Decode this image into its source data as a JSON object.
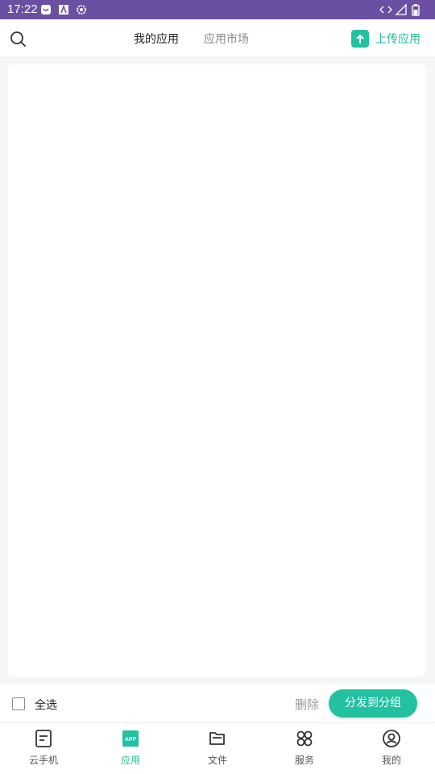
{
  "status_bar": {
    "time": "17:22"
  },
  "header": {
    "tabs": [
      {
        "label": "我的应用",
        "active": true
      },
      {
        "label": "应用市场",
        "active": false
      }
    ],
    "upload_label": "上传应用"
  },
  "action_bar": {
    "select_all_label": "全选",
    "delete_label": "删除",
    "distribute_label": "分发到分组"
  },
  "bottom_nav": {
    "items": [
      {
        "label": "云手机",
        "icon": "phone-document-icon",
        "active": false
      },
      {
        "label": "应用",
        "icon": "app-icon",
        "active": true
      },
      {
        "label": "文件",
        "icon": "folder-icon",
        "active": false
      },
      {
        "label": "服务",
        "icon": "services-grid-icon",
        "active": false
      },
      {
        "label": "我的",
        "icon": "user-icon",
        "active": false
      }
    ]
  },
  "colors": {
    "accent": "#22c2a0",
    "status_bar": "#6a4fa3"
  }
}
